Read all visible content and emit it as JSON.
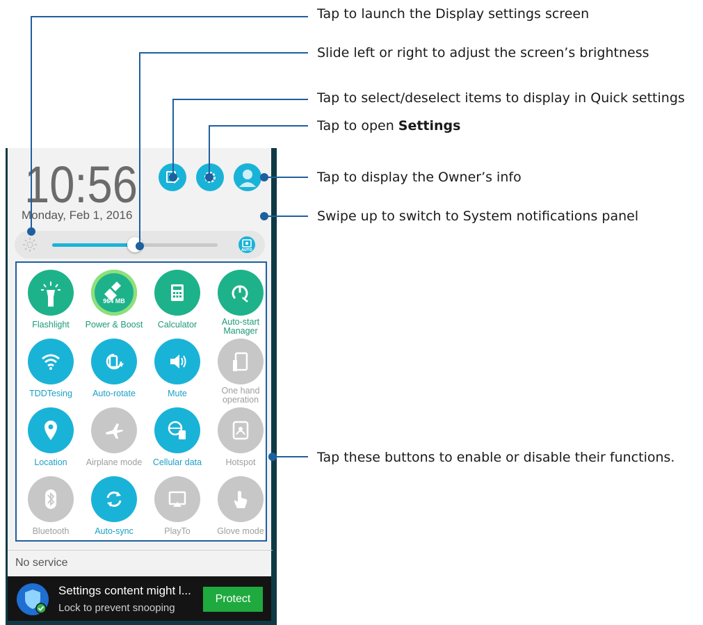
{
  "callouts": [
    {
      "text": "Tap to launch the Display settings screen"
    },
    {
      "text": "Slide left or right to adjust the screen’s brightness"
    },
    {
      "text": "Tap to select/deselect items to display in Quick settings"
    },
    {
      "text_prefix": "Tap to open ",
      "text_bold": "Settings"
    },
    {
      "text": "Tap to display the Owner’s info"
    },
    {
      "text": "Swipe up to switch to System notifications panel"
    },
    {
      "text": "Tap these buttons to enable or disable their functions."
    }
  ],
  "phone": {
    "clock": "10:56",
    "date": "Monday, Feb 1, 2016",
    "brightness": {
      "level_fraction": 0.5,
      "auto_badge": "AUTO"
    },
    "top_icons": [
      "edit-quick-settings-icon",
      "settings-gear-icon",
      "owner-avatar-icon"
    ],
    "tiles": [
      {
        "label": "Flashlight",
        "state": "on",
        "icon": "flashlight-icon"
      },
      {
        "label": "Power & Boost",
        "state": "on",
        "icon": "broom-icon",
        "badge": "964 MB"
      },
      {
        "label": "Calculator",
        "state": "on",
        "icon": "calculator-icon"
      },
      {
        "label": "Auto-start Manager",
        "state": "on",
        "icon": "auto-start-icon"
      },
      {
        "label": "TDDTesing",
        "state": "on",
        "icon": "wifi-icon"
      },
      {
        "label": "Auto-rotate",
        "state": "on",
        "icon": "auto-rotate-icon"
      },
      {
        "label": "Mute",
        "state": "on",
        "icon": "mute-icon"
      },
      {
        "label": "One hand operation",
        "state": "off",
        "icon": "one-hand-icon"
      },
      {
        "label": "Location",
        "state": "on",
        "icon": "location-icon"
      },
      {
        "label": "Airplane mode",
        "state": "off",
        "icon": "airplane-icon"
      },
      {
        "label": "Cellular data",
        "state": "on",
        "icon": "cellular-data-icon"
      },
      {
        "label": "Hotspot",
        "state": "off",
        "icon": "hotspot-icon"
      },
      {
        "label": "Bluetooth",
        "state": "off",
        "icon": "bluetooth-icon"
      },
      {
        "label": "Auto-sync",
        "state": "on",
        "icon": "sync-icon"
      },
      {
        "label": "PlayTo",
        "state": "off",
        "icon": "playto-icon"
      },
      {
        "label": "Glove mode",
        "state": "off",
        "icon": "glove-icon"
      }
    ],
    "status": "No service",
    "notification": {
      "title": "Settings content might l...",
      "subtitle": "Lock to prevent snooping",
      "button": "Protect"
    }
  },
  "colors": {
    "accent": "#1ab3d8",
    "green": "#1eb28a",
    "off": "#c7c7c7",
    "callout_line": "#1e5f9e"
  }
}
